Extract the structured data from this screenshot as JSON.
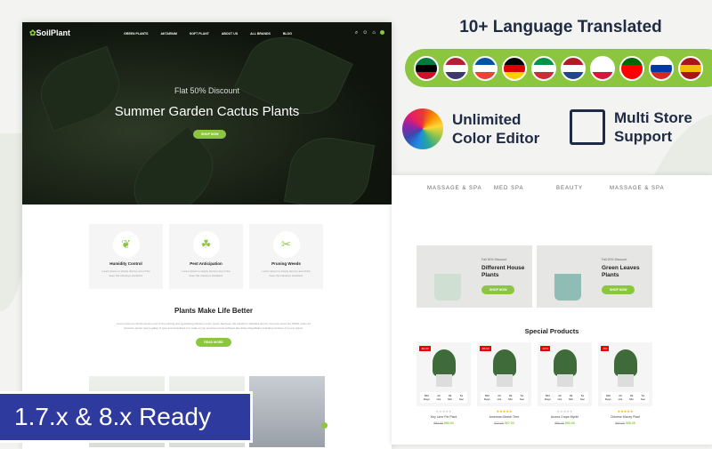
{
  "header": {
    "logo": "SoilPlant",
    "nav": [
      "GREEN PLANTS",
      "AKTARIUM",
      "SOFT PLANT",
      "ABOUT US",
      "ALL BRANDS",
      "BLOG"
    ]
  },
  "hero": {
    "subtitle": "Flat 50% Discount",
    "title": "Summer Garden Cactus Plants",
    "button": "SHOP NOW"
  },
  "features": [
    {
      "title": "Humidity Control",
      "text": "Lorem Ipsum is simply dummy text of the been the industrys standard."
    },
    {
      "title": "Pest Anticipation",
      "text": "Lorem Ipsum is simply dummy text of the been the industrys standard."
    },
    {
      "title": "Pruning Weeds",
      "text": "Lorem Ipsum is simply dummy text of the been the industrys standard."
    }
  ],
  "about": {
    "title": "Plants Make Life Better",
    "text": "Lorem Ipsum is simply dummy text of the printing and typesetting industry Lorem Ipsum has been the industry's standard dummy text ever since the 1500s, when an unknown printer took a galley of type and scrambled it to make a type specimen book software like Aldus PageMaker including versions of Lorem Ipsum.",
    "button": "READ MORE"
  },
  "badge": "1.7.x & 8.x Ready",
  "promo": {
    "languages": "10+ Language Translated",
    "color_editor": "Unlimited Color Editor",
    "multi_store": "Multi Store Support",
    "flags": [
      [
        "#007a3d",
        "#000",
        "#ce1126"
      ],
      [
        "#b22234",
        "#fff",
        "#3c3b6e"
      ],
      [
        "#0055a4",
        "#fff",
        "#ef4135"
      ],
      [
        "#000",
        "#dd0000",
        "#ffce00"
      ],
      [
        "#009246",
        "#fff",
        "#ce2b37"
      ],
      [
        "#ae1c28",
        "#fff",
        "#21468b"
      ],
      [
        "#fff",
        "#fff",
        "#dc143c"
      ],
      [
        "#006600",
        "#ff0000",
        "#ff0000"
      ],
      [
        "#fff",
        "#0039a6",
        "#d52b1e"
      ],
      [
        "#aa151b",
        "#f1bf00",
        "#aa151b"
      ]
    ]
  },
  "brands": [
    "MASSAGE & SPA",
    "MED SPA",
    "BEAUTY",
    "MASSAGE & SPA"
  ],
  "banners": [
    {
      "tag": "Fall 30% Discount",
      "title": "Different House Plants",
      "button": "SHOP NOW"
    },
    {
      "tag": "Fall 20% Discount",
      "title": "Green Leaves Plants",
      "button": "SHOP NOW"
    }
  ],
  "special": {
    "title": "Special Products",
    "products": [
      {
        "name": "Key Lime Pie Plant",
        "badge": "-$4.00",
        "old": "$84.00",
        "price": "$80.00",
        "timer": [
          "563",
          "20",
          "09",
          "51"
        ],
        "rated": false
      },
      {
        "name": "American Beech Tree",
        "badge": "-$5.00",
        "old": "$72.00",
        "price": "$67.00",
        "timer": [
          "563",
          "20",
          "09",
          "51"
        ],
        "rated": true
      },
      {
        "name": "Aroma Crape Myrtle",
        "badge": "-10%",
        "old": "$56.00",
        "price": "$50.36",
        "timer": [
          "564",
          "20",
          "09",
          "51"
        ],
        "rated": false
      },
      {
        "name": "Chinese Money Plant",
        "badge": "-6%",
        "old": "$62.00",
        "price": "$58.28",
        "timer": [
          "929",
          "20",
          "09",
          "51"
        ],
        "rated": true
      }
    ],
    "timer_labels": [
      "Days",
      "Hrs",
      "Min",
      "Sec"
    ]
  },
  "colors": {
    "accent": "#8cc63f",
    "badge_blue": "#2f3a9e",
    "dark_text": "#1f2a44"
  }
}
